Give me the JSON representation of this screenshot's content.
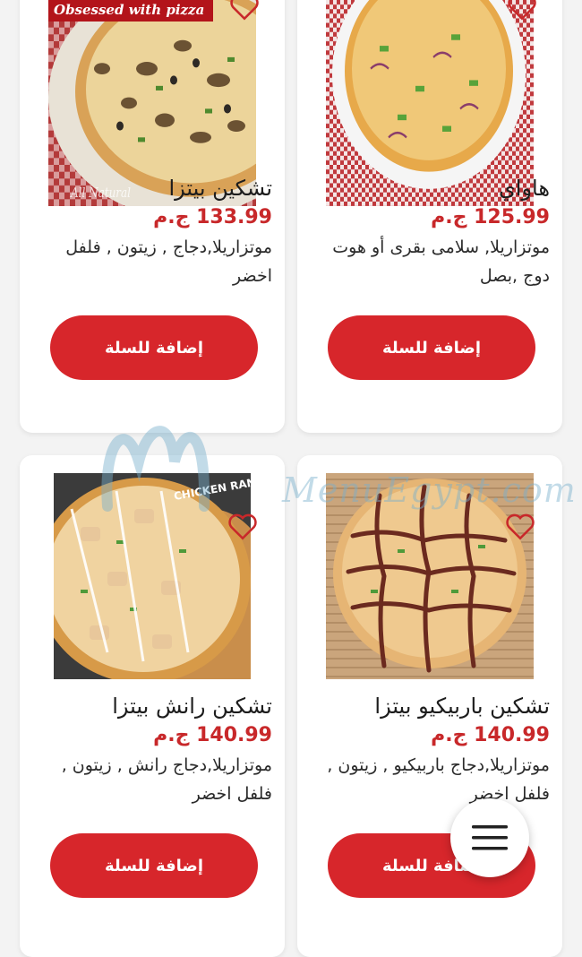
{
  "brand_watermark": "MenuEgypt.com",
  "products": [
    {
      "title": "تشكين بيتزا",
      "price": "133.99 ج.م",
      "description": "موتزاريلا,دجاج , زيتون , فلفل اخضر",
      "button_label": "إضافة للسلة",
      "image_badge": "Obsessed with pizza",
      "image_caption": "All Natural"
    },
    {
      "title": "هاواي",
      "price": "125.99 ج.م",
      "description": "موتزاريلا, سلامى بقرى أو هوت دوج ,بصل",
      "button_label": "إضافة للسلة"
    },
    {
      "title": "تشكين رانش بيتزا",
      "price": "140.99 ج.م",
      "description": "موتزاريلا,دجاج رانش , زيتون , فلفل اخضر",
      "button_label": "إضافة للسلة",
      "image_caption": "CHICKEN RANCH"
    },
    {
      "title": "تشكين باربيكيو بيتزا",
      "price": "140.99 ج.م",
      "description": "موتزاريلا,دجاج باربيكيو , زيتون , فلفل اخضر",
      "button_label": "إضافة للسلة"
    }
  ],
  "icons": {
    "favorite": "heart-outline-icon",
    "menu": "hamburger-menu-icon"
  },
  "colors": {
    "accent": "#d7262b",
    "price": "#c8282a",
    "background": "#f3f3f3"
  }
}
